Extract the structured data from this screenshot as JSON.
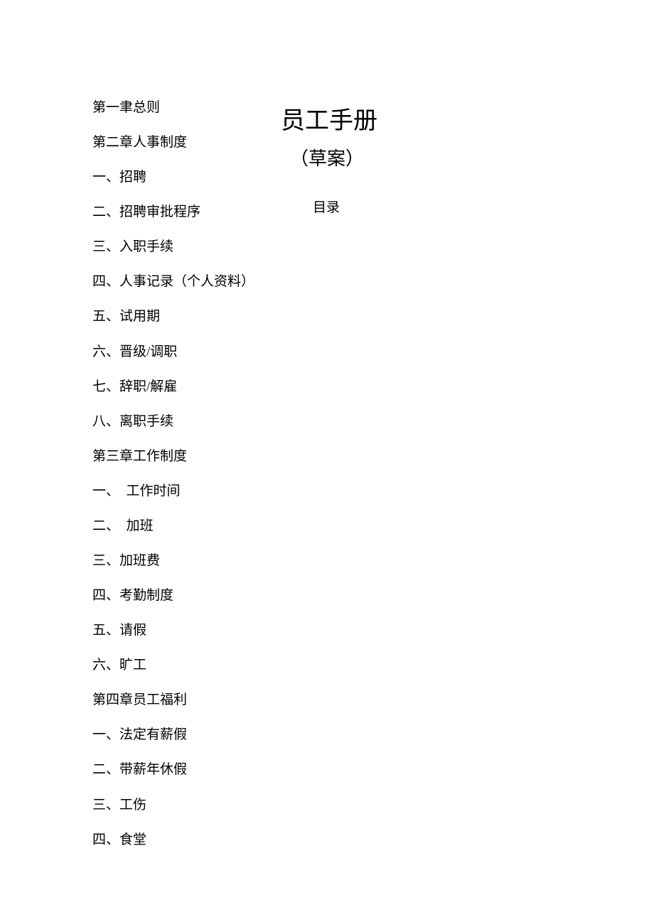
{
  "title": "员工手册",
  "subtitle": "（草案）",
  "toc_label": "目录",
  "toc": [
    "第一聿总则",
    "第二章人事制度",
    "一、招聘",
    "二、招聘审批程序",
    "三、入职手续",
    "四、人事记录（个人资料）",
    "五、试用期",
    "六、晋级/调职",
    "七、辞职/解雇",
    "八、离职手续",
    "第三章工作制度",
    "一、　工作时间",
    "二、　加班",
    "三、加班费",
    "四、考勤制度",
    "五、请假",
    "六、旷工",
    "第四章员工福利",
    "一、法定有薪假",
    "二、带薪年休假",
    "三、工伤",
    "四、食堂"
  ]
}
